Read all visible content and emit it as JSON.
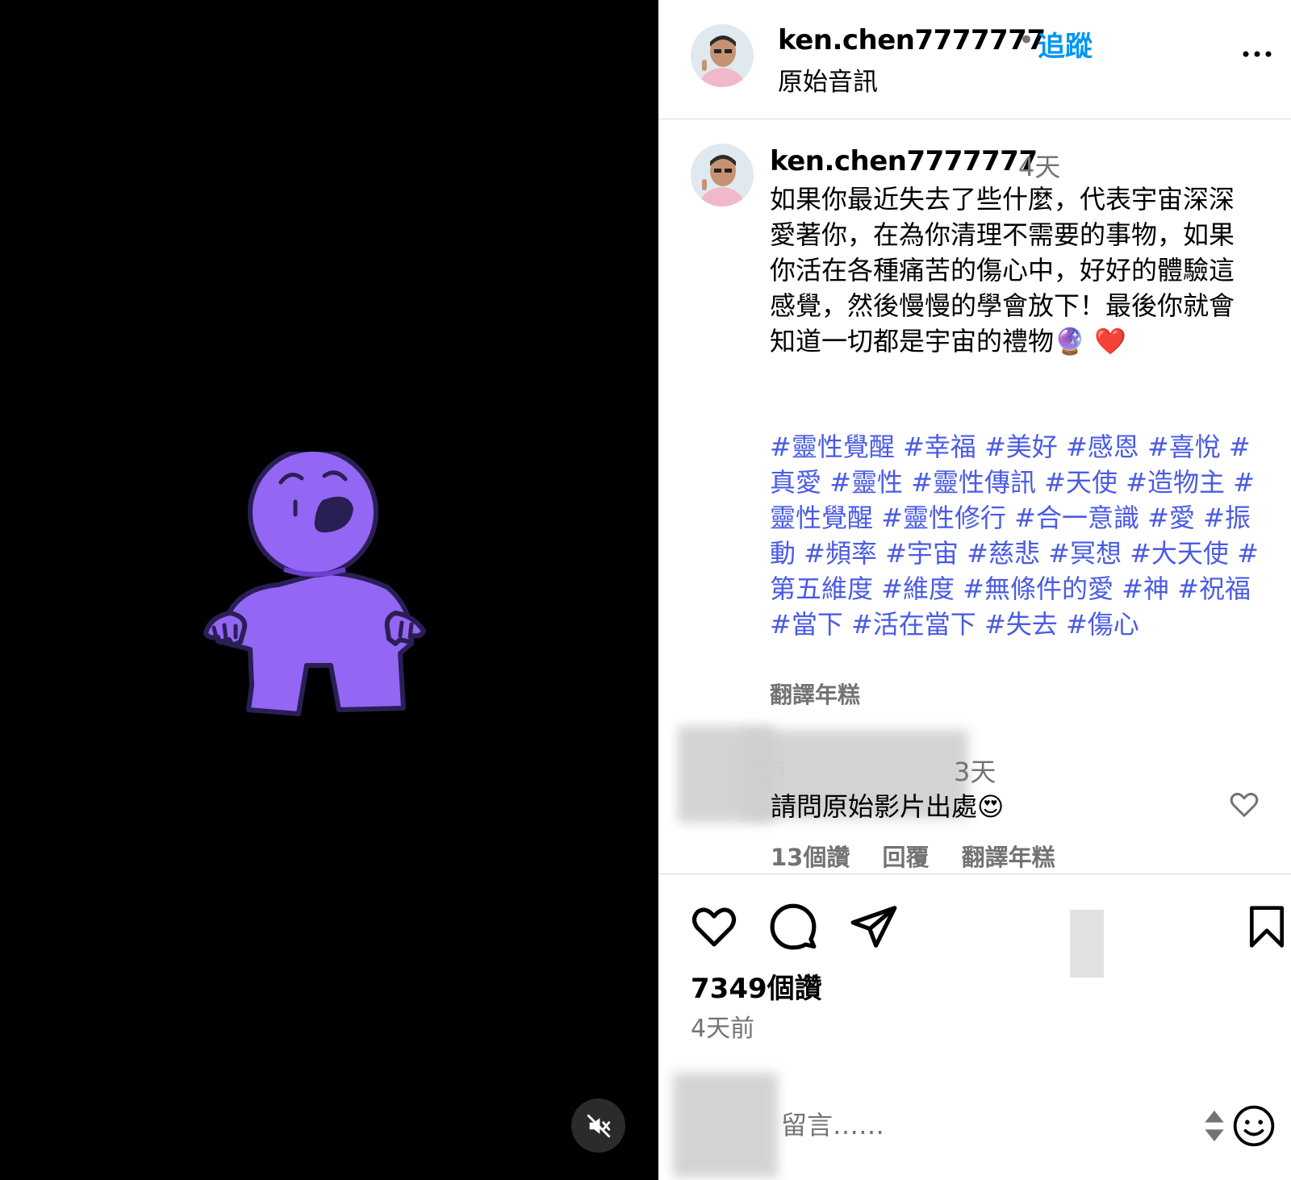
{
  "post": {
    "username": "ken.chen7777777",
    "follow_label": "追蹤",
    "audio_label": "原始音訊",
    "time_short": "4天",
    "caption": "如果你最近失去了些什麼，代表宇宙深深愛著你，在為你清理不需要的事物，如果你活在各種痛苦的傷心中，好好的體驗這感覺，然後慢慢的學會放下！最後你就會知道一切都是宇宙的禮物🔮 ❤️",
    "hashtags": "#靈性覺醒 #幸福 #美好 #感恩 #喜悅 #真愛 #靈性 #靈性傳訊 #天使 #造物主 #靈性覺醒 #靈性修行 #合一意識 #愛 #振動 #頻率 #宇宙 #慈悲 #冥想 #大天使 #第五維度 #維度 #無條件的愛 #神 #祝福 #當下 #活在當下 #失去 #傷心",
    "translate_label": "翻譯年糕"
  },
  "comment": {
    "author": "ya",
    "time": "3天",
    "text": "請問原始影片出處😍",
    "likes": "13個讚",
    "reply": "回覆",
    "translate": "翻譯年糕"
  },
  "stats": {
    "likes": "7349個讚",
    "age": "4天前"
  },
  "composer": {
    "placeholder": "留言……"
  },
  "icons": [
    "more-icon",
    "mute-icon",
    "heart-icon",
    "comment-icon",
    "share-icon",
    "bookmark-icon",
    "emoji-icon",
    "sort-icon"
  ],
  "colors": {
    "link": "#0095f6",
    "hashtag": "#4a5be5",
    "character": "#9466f4"
  }
}
